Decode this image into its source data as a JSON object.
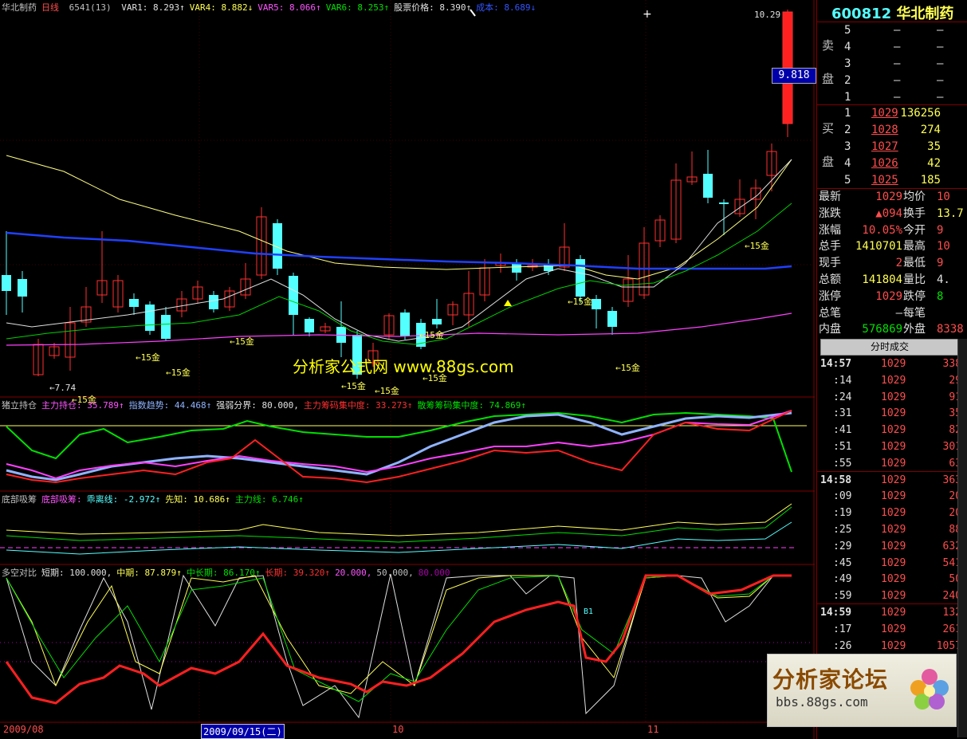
{
  "main_legend": {
    "name": "华北制药",
    "period": "日线",
    "code_info": "6541(13)",
    "items": [
      {
        "text": "VAR1: 8.293↑",
        "color": "#e0e0e0"
      },
      {
        "text": "VAR4: 8.882↓",
        "color": "#ffff54"
      },
      {
        "text": "VAR5: 8.066↑",
        "color": "#ff54ff"
      },
      {
        "text": "VAR6: 8.253↑",
        "color": "#00e000"
      },
      {
        "text": "股票价格: 8.390↑",
        "color": "#e0e0e0"
      },
      {
        "text": "成本: 8.689↓",
        "color": "#3355ff"
      }
    ]
  },
  "price_labels": {
    "high": "10.29",
    "low": "7.74",
    "current_box": "9.818",
    "site": "分析家公式网 www.88gs.com",
    "marker_b1": "B1"
  },
  "gold_labels": [
    "←15金",
    "←15金",
    "←15金",
    "←15金",
    "←15金",
    "←15金",
    "←15金",
    "←15金",
    "←15金",
    "←15金",
    "←15金"
  ],
  "sub1_legend": {
    "name": "猪立持仓",
    "items": [
      {
        "text": "主力持仓: 35.789↑",
        "color": "#ff54ff"
      },
      {
        "text": "指数趋势: 44.468↑",
        "color": "#8fb3ff"
      },
      {
        "text": "强弱分界: 80.000,",
        "color": "#e0e0e0"
      },
      {
        "text": "主力筹码集中度: 33.273↑",
        "color": "#ff3030"
      },
      {
        "text": "散筹筹码集中度: 74.869↑",
        "color": "#00e000"
      }
    ]
  },
  "sub2_legend": {
    "name": "底部吸筹",
    "items": [
      {
        "text": "底部吸筹:",
        "color": "#ff54ff"
      },
      {
        "text": "乖离线: -2.972↑",
        "color": "#54ffff"
      },
      {
        "text": "先知: 10.686↑",
        "color": "#ffff54"
      },
      {
        "text": "主力线: 6.746↑",
        "color": "#00e000"
      }
    ]
  },
  "sub3_legend": {
    "name": "多空对比",
    "items": [
      {
        "text": "短期: 100.000,",
        "color": "#e0e0e0"
      },
      {
        "text": "中期: 87.879↑",
        "color": "#ffff54"
      },
      {
        "text": "中长期: 86.170↑",
        "color": "#00e000"
      },
      {
        "text": "长期: 39.320↑",
        "color": "#ff3030"
      },
      {
        "text": "20.000,",
        "color": "#ff54ff"
      },
      {
        "text": "50.000,",
        "color": "#c0c0c0"
      },
      {
        "text": "80.000",
        "color": "#aa00aa"
      }
    ]
  },
  "axis_dates": {
    "left": "2009/08",
    "cursor": "2009/09/15(二)",
    "m10": "10",
    "m11": "11"
  },
  "panel": {
    "code": "600812",
    "name": "华北制药",
    "sell_label": [
      "卖",
      "盘"
    ],
    "buy_label": [
      "买",
      "盘"
    ],
    "sell": [
      {
        "lvl": "5",
        "price": "—",
        "vol": "—"
      },
      {
        "lvl": "4",
        "price": "—",
        "vol": "—"
      },
      {
        "lvl": "3",
        "price": "—",
        "vol": "—"
      },
      {
        "lvl": "2",
        "price": "—",
        "vol": "—"
      },
      {
        "lvl": "1",
        "price": "—",
        "vol": "—"
      }
    ],
    "buy": [
      {
        "lvl": "1",
        "price": "1029",
        "vol": "136256"
      },
      {
        "lvl": "2",
        "price": "1028",
        "vol": "274"
      },
      {
        "lvl": "3",
        "price": "1027",
        "vol": "35"
      },
      {
        "lvl": "4",
        "price": "1026",
        "vol": "42"
      },
      {
        "lvl": "5",
        "price": "1025",
        "vol": "185"
      }
    ],
    "stats": [
      {
        "l1": "最新",
        "v1": "1029",
        "c1": "red",
        "l2": "均价",
        "v2": "10",
        "c2": "red"
      },
      {
        "l1": "涨跌",
        "v1": "▲094",
        "c1": "red",
        "l2": "换手",
        "v2": "13.7",
        "c2": "yel"
      },
      {
        "l1": "涨幅",
        "v1": "10.05%",
        "c1": "red",
        "l2": "今开",
        "v2": "9",
        "c2": "red"
      },
      {
        "l1": "总手",
        "v1": "1410701",
        "c1": "yel",
        "l2": "最高",
        "v2": "10",
        "c2": "red"
      },
      {
        "l1": "现手",
        "v1": "2",
        "c1": "red",
        "l2": "最低",
        "v2": "9",
        "c2": "red"
      },
      {
        "l1": "总额",
        "v1": "141804",
        "c1": "yel",
        "l2": "量比",
        "v2": "4.",
        "c2": "wht"
      },
      {
        "l1": "涨停",
        "v1": "1029",
        "c1": "red",
        "l2": "跌停",
        "v2": "8",
        "c2": "green"
      },
      {
        "l1": "总笔",
        "v1": "—",
        "c1": "wht",
        "l2": "每笔",
        "v2": "",
        "c2": "wht"
      },
      {
        "l1": "内盘",
        "v1": "576869",
        "c1": "green",
        "l2": "外盘",
        "v2": "8338",
        "c2": "red"
      }
    ],
    "tick_tab": "分时成交",
    "ticks": [
      {
        "t": "14:57",
        "p": "1029",
        "v": "338",
        "bold": true
      },
      {
        "t": ":14",
        "p": "1029",
        "v": "29"
      },
      {
        "t": ":24",
        "p": "1029",
        "v": "91"
      },
      {
        "t": ":31",
        "p": "1029",
        "v": "35"
      },
      {
        "t": ":41",
        "p": "1029",
        "v": "82"
      },
      {
        "t": ":51",
        "p": "1029",
        "v": "301"
      },
      {
        "t": ":55",
        "p": "1029",
        "v": "63"
      },
      {
        "t": "14:58",
        "p": "1029",
        "v": "363",
        "bold": true
      },
      {
        "t": ":09",
        "p": "1029",
        "v": "20"
      },
      {
        "t": ":19",
        "p": "1029",
        "v": "20"
      },
      {
        "t": ":25",
        "p": "1029",
        "v": "88"
      },
      {
        "t": ":29",
        "p": "1029",
        "v": "632"
      },
      {
        "t": ":45",
        "p": "1029",
        "v": "541"
      },
      {
        "t": ":49",
        "p": "1029",
        "v": "50"
      },
      {
        "t": ":59",
        "p": "1029",
        "v": "240"
      },
      {
        "t": "14:59",
        "p": "1029",
        "v": "132",
        "bold": true
      },
      {
        "t": ":17",
        "p": "1029",
        "v": "261"
      },
      {
        "t": ":26",
        "p": "1029",
        "v": "1057"
      }
    ]
  },
  "forum": {
    "title": "分析家论坛",
    "url": "bbs.88gs.com"
  }
}
